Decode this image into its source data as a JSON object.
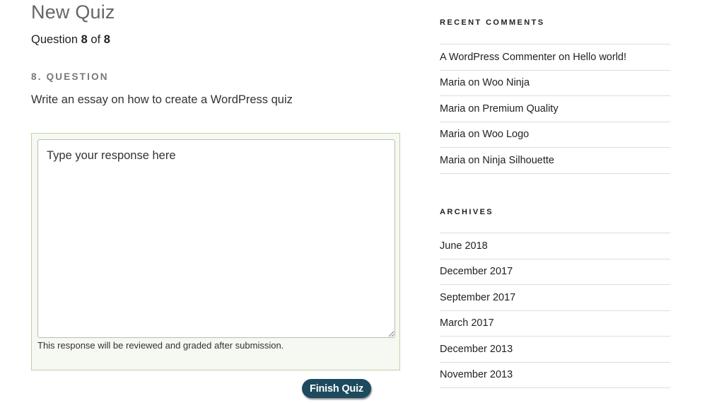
{
  "quiz": {
    "title": "New Quiz",
    "progress": {
      "prefix": "Question",
      "current": "8",
      "of_label": "of",
      "total": "8"
    },
    "question_heading": "8. Question",
    "question_text": "Write an essay on how to create a WordPress quiz",
    "response_placeholder": "Type your response here",
    "response_value": "",
    "hint": "This response will be reviewed and graded after submission.",
    "finish_label": "Finish Quiz"
  },
  "sidebar": {
    "recent_comments": {
      "title": "Recent Comments",
      "items": [
        {
          "author": "A WordPress Commenter",
          "on": "on",
          "post": "Hello world!"
        },
        {
          "author": "Maria",
          "on": "on",
          "post": "Woo Ninja"
        },
        {
          "author": "Maria",
          "on": "on",
          "post": "Premium Quality"
        },
        {
          "author": "Maria",
          "on": "on",
          "post": "Woo Logo"
        },
        {
          "author": "Maria",
          "on": "on",
          "post": "Ninja Silhouette"
        }
      ]
    },
    "archives": {
      "title": "Archives",
      "items": [
        "June 2018",
        "December 2017",
        "September 2017",
        "March 2017",
        "December 2013",
        "November 2013"
      ]
    }
  },
  "colors": {
    "button_bg": "#1d4a5e",
    "answer_box_bg": "#f6f8f2",
    "answer_box_border": "#c3d0a6"
  }
}
